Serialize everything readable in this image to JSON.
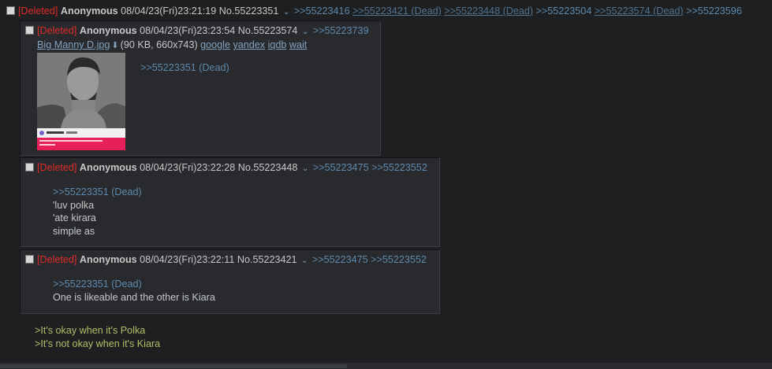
{
  "op": {
    "deleted_tag": "[Deleted]",
    "name": "Anonymous",
    "date": "08/04/23(Fri)23:21:19",
    "post_no": "No.55223351",
    "backlinks": [
      {
        "text": ">>55223416",
        "dead": false
      },
      {
        "text": ">>55223421 (Dead)",
        "dead": true
      },
      {
        "text": ">>55223448 (Dead)",
        "dead": true
      },
      {
        "text": ">>55223504",
        "dead": false
      },
      {
        "text": ">>55223574 (Dead)",
        "dead": true
      },
      {
        "text": ">>55223596",
        "dead": false
      }
    ],
    "greentext": [
      ">It's okay when it's Polka",
      ">It's not okay when it's Kiara"
    ]
  },
  "replies": [
    {
      "deleted_tag": "[Deleted]",
      "name": "Anonymous",
      "date": "08/04/23(Fri)23:23:54",
      "post_no": "No.55223574",
      "backlinks": [
        ">>55223739"
      ],
      "file": {
        "name": "Big Manny D.jpg",
        "meta": "(90 KB, 660x743)",
        "search_links": [
          "google",
          "yandex",
          "iqdb",
          "wait"
        ]
      },
      "quote": ">>55223351 (Dead)",
      "lines": []
    },
    {
      "deleted_tag": "[Deleted]",
      "name": "Anonymous",
      "date": "08/04/23(Fri)23:22:28",
      "post_no": "No.55223448",
      "backlinks": [
        ">>55223475",
        ">>55223552"
      ],
      "quote": ">>55223351 (Dead)",
      "lines": [
        "'luv polka",
        "'ate kirara",
        "simple as"
      ]
    },
    {
      "deleted_tag": "[Deleted]",
      "name": "Anonymous",
      "date": "08/04/23(Fri)23:22:11",
      "post_no": "No.55223421",
      "backlinks": [
        ">>55223475",
        ">>55223552"
      ],
      "quote": ">>55223351 (Dead)",
      "lines": [
        "One is likeable and the other is Kiara"
      ]
    }
  ],
  "colors": {
    "background": "#1d1f21",
    "reply_bg": "#282a2e",
    "deleted": "#e02a2a",
    "link": "#81a2be",
    "quotelink": "#5f89ac",
    "greentext": "#b5bd68",
    "thumb_banner": "#e8205a"
  },
  "icons": {
    "post_menu": "chevron-down-icon",
    "download": "download-icon"
  }
}
